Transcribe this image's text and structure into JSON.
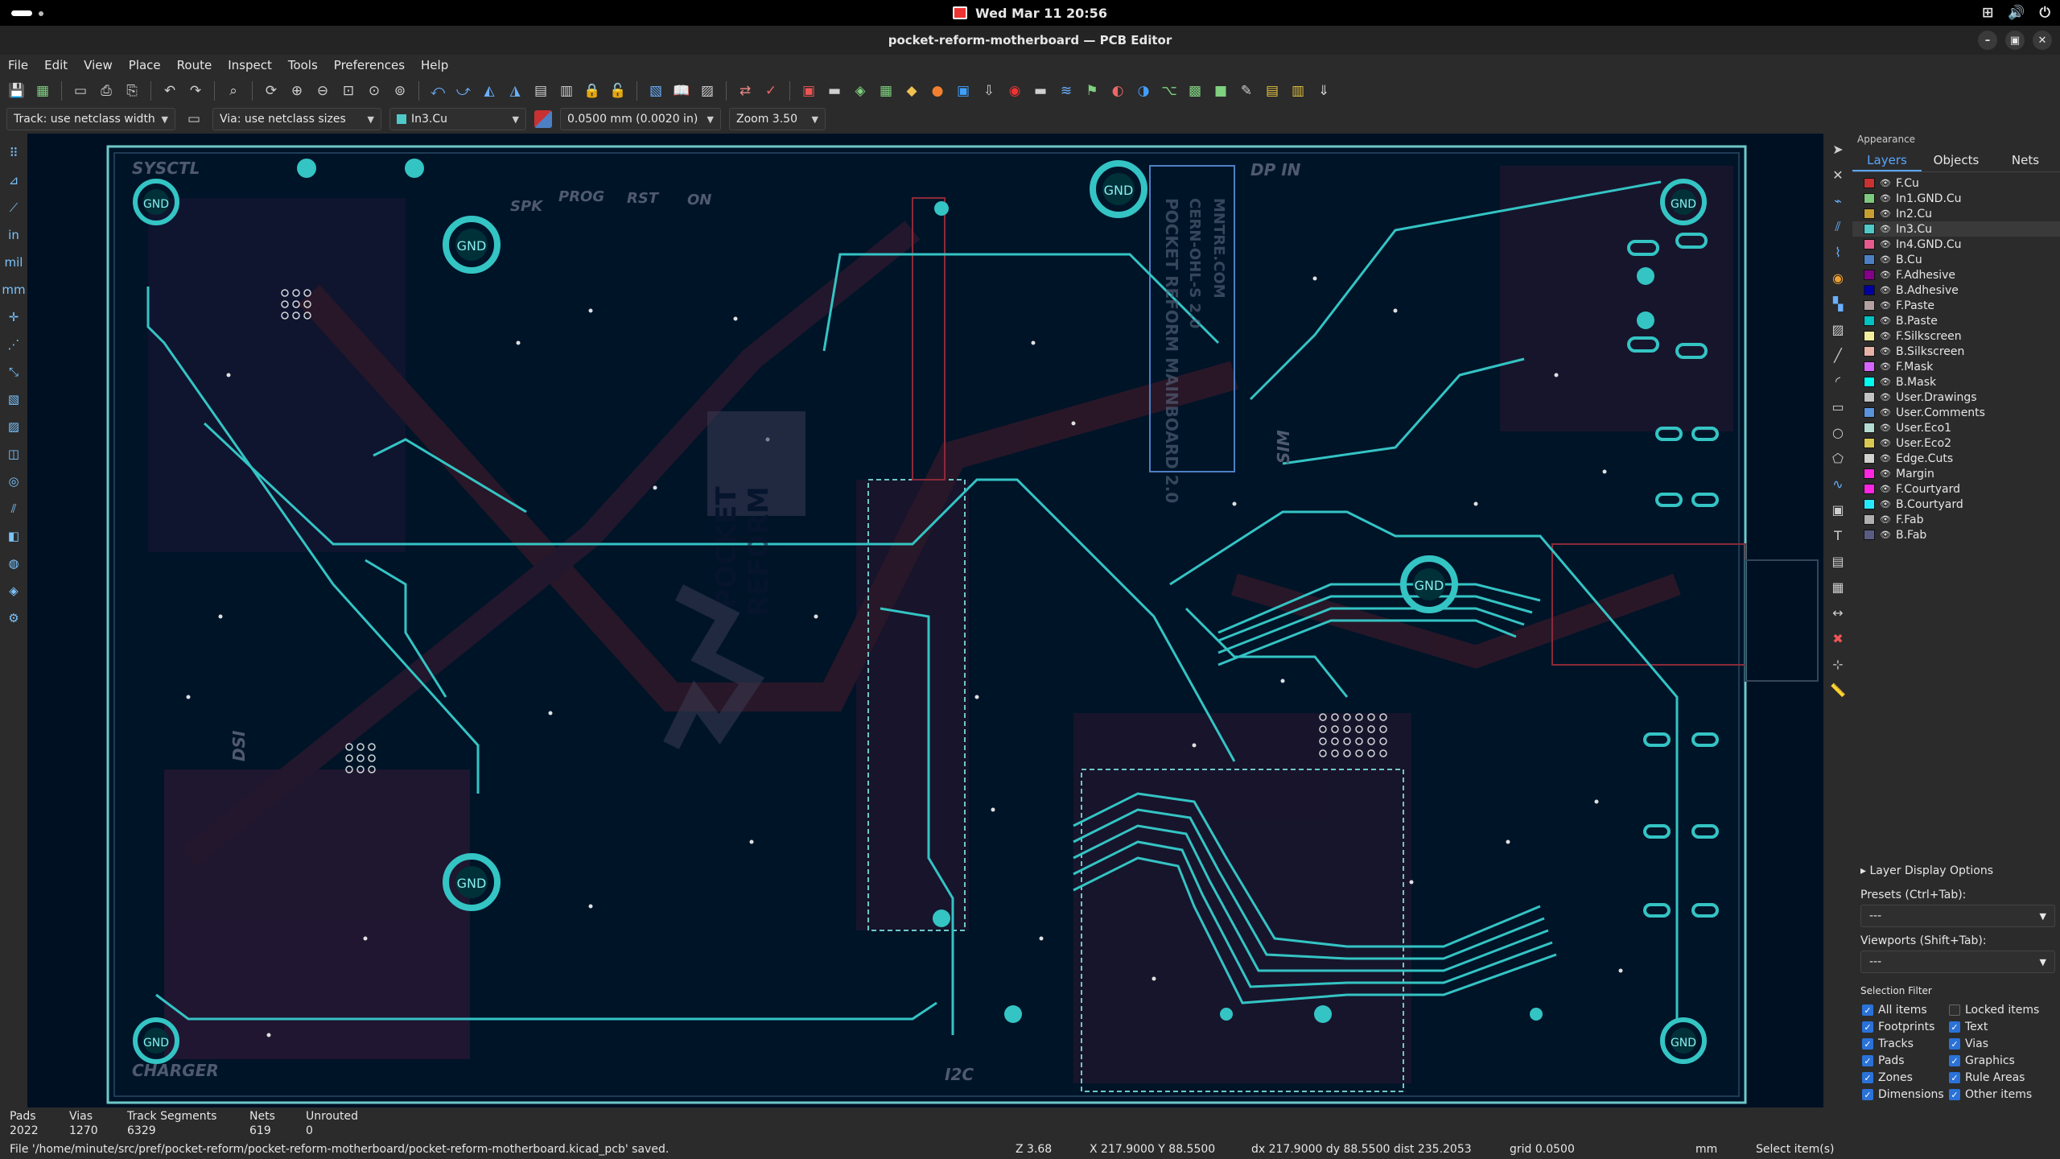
{
  "topbar": {
    "clock": "Wed Mar 11  20:56"
  },
  "window": {
    "title": "pocket-reform-motherboard — PCB Editor"
  },
  "menu": [
    "File",
    "Edit",
    "View",
    "Place",
    "Route",
    "Inspect",
    "Tools",
    "Preferences",
    "Help"
  ],
  "aux": {
    "track_width": "Track: use netclass width",
    "via_size": "Via: use netclass sizes",
    "layer": "In3.Cu",
    "grid": "0.0500 mm (0.0020 in)",
    "zoom": "Zoom 3.50"
  },
  "panel": {
    "title": "Appearance",
    "tabs": [
      "Layers",
      "Objects",
      "Nets"
    ],
    "layers": [
      {
        "name": "F.Cu",
        "color": "#c83232"
      },
      {
        "name": "In1.GND.Cu",
        "color": "#7fc87f"
      },
      {
        "name": "In2.Cu",
        "color": "#c8a032"
      },
      {
        "name": "In3.Cu",
        "color": "#4fc8c8"
      },
      {
        "name": "In4.GND.Cu",
        "color": "#e65a8c"
      },
      {
        "name": "B.Cu",
        "color": "#4d7fc4"
      },
      {
        "name": "F.Adhesive",
        "color": "#84008a"
      },
      {
        "name": "B.Adhesive",
        "color": "#0000a0"
      },
      {
        "name": "F.Paste",
        "color": "#b4a0a0"
      },
      {
        "name": "B.Paste",
        "color": "#00c2c2"
      },
      {
        "name": "F.Silkscreen",
        "color": "#f2ed9c"
      },
      {
        "name": "B.Silkscreen",
        "color": "#e8b2a7"
      },
      {
        "name": "F.Mask",
        "color": "#d864ff"
      },
      {
        "name": "B.Mask",
        "color": "#02ffee"
      },
      {
        "name": "User.Drawings",
        "color": "#c2c2c2"
      },
      {
        "name": "User.Comments",
        "color": "#5994dc"
      },
      {
        "name": "User.Eco1",
        "color": "#b4dbd2"
      },
      {
        "name": "User.Eco2",
        "color": "#d8c852"
      },
      {
        "name": "Edge.Cuts",
        "color": "#d0d2cd"
      },
      {
        "name": "Margin",
        "color": "#ff26e2"
      },
      {
        "name": "F.Courtyard",
        "color": "#ff26e2"
      },
      {
        "name": "B.Courtyard",
        "color": "#26e9ff"
      },
      {
        "name": "F.Fab",
        "color": "#afafaf"
      },
      {
        "name": "B.Fab",
        "color": "#585d84"
      }
    ],
    "active_layer": "In3.Cu",
    "layer_display_options": "Layer Display Options",
    "presets_label": "Presets (Ctrl+Tab):",
    "presets_value": "---",
    "viewports_label": "Viewports (Shift+Tab):",
    "viewports_value": "---",
    "selection_filter_label": "Selection Filter",
    "filters": [
      {
        "label": "All items",
        "checked": true
      },
      {
        "label": "Locked items",
        "checked": false
      },
      {
        "label": "Footprints",
        "checked": true
      },
      {
        "label": "Text",
        "checked": true
      },
      {
        "label": "Tracks",
        "checked": true
      },
      {
        "label": "Vias",
        "checked": true
      },
      {
        "label": "Pads",
        "checked": true
      },
      {
        "label": "Graphics",
        "checked": true
      },
      {
        "label": "Zones",
        "checked": true
      },
      {
        "label": "Rule Areas",
        "checked": true
      },
      {
        "label": "Dimensions",
        "checked": true
      },
      {
        "label": "Other items",
        "checked": true
      }
    ]
  },
  "board": {
    "labels": {
      "sysctl": "SYSCTL",
      "spk": "SPK",
      "prog": "PROG",
      "rst": "RST",
      "on": "ON",
      "dp_in": "DP IN",
      "sim": "SIM",
      "dsi": "DSI",
      "charger": "CHARGER",
      "i2c": "I2C",
      "gnd": "GND",
      "logo_line1": "POCKET",
      "logo_line2": "REFORM",
      "silk_title": "POCKET REFORM MAINBOARD 2.0",
      "silk_cert": "CERN-OHL-S 2.0",
      "silk_site": "MNTRE.COM"
    }
  },
  "status": {
    "pads_label": "Pads",
    "pads": "2022",
    "vias_label": "Vias",
    "vias": "1270",
    "segments_label": "Track Segments",
    "segments": "6329",
    "nets_label": "Nets",
    "nets": "619",
    "unrouted_label": "Unrouted",
    "unrouted": "0",
    "message": "File '/home/minute/src/pref/pocket-reform/pocket-reform-motherboard/pocket-reform-motherboard.kicad_pcb' saved.",
    "zoom": "Z 3.68",
    "cursor": "X 217.9000  Y 88.5500",
    "delta": "dx 217.9000  dy 88.5500  dist 235.2053",
    "grid": "grid 0.0500",
    "units": "mm",
    "mode": "Select item(s)"
  }
}
